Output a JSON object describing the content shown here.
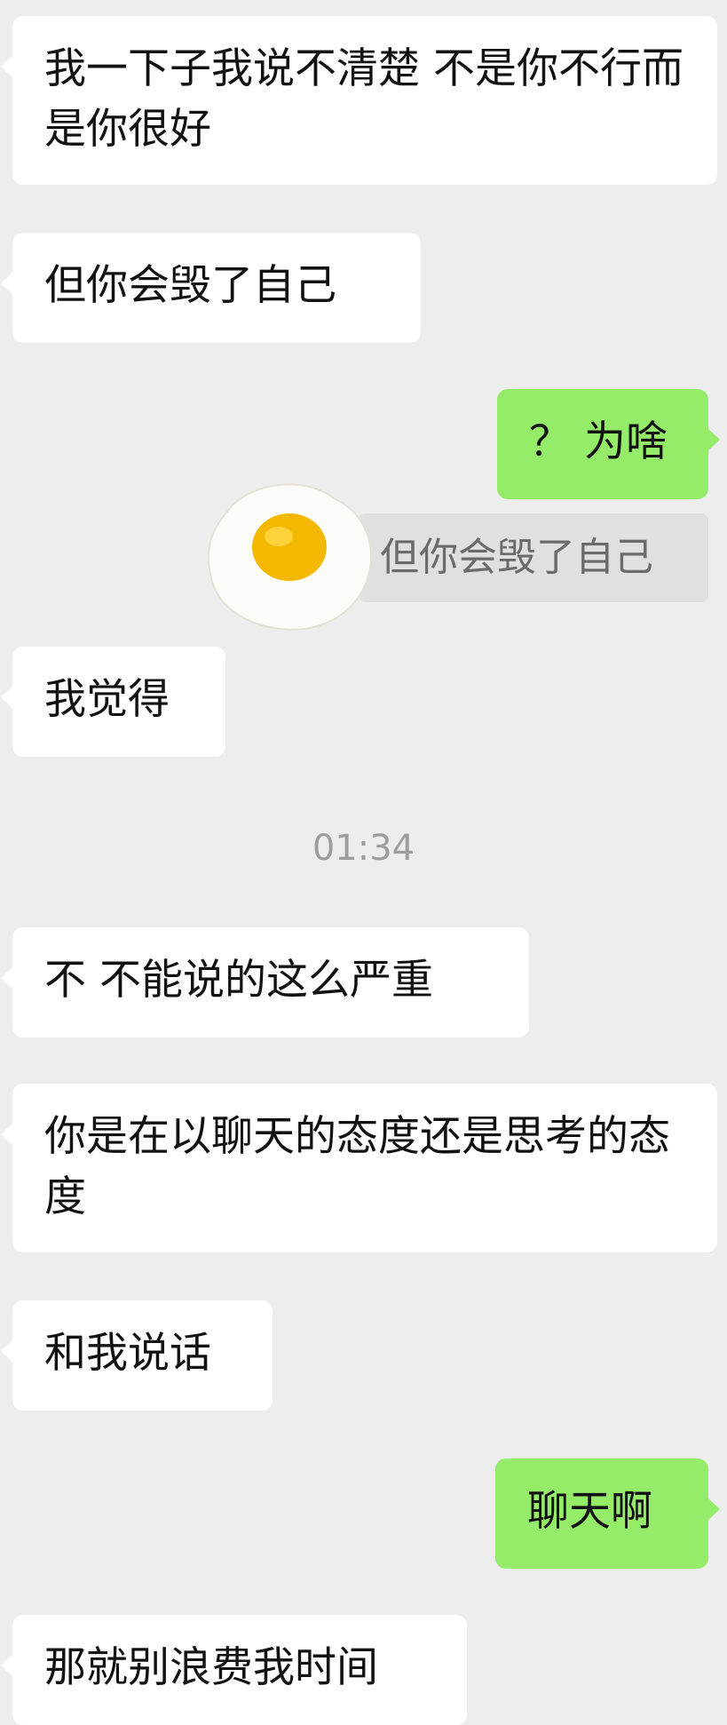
{
  "messages": [
    {
      "side": "left",
      "text": "我一下子我说不清楚 不是你不行而是你很好"
    },
    {
      "side": "left",
      "text": "但你会毁了自己"
    },
    {
      "side": "right",
      "text": "？ 为啥"
    },
    {
      "side": "left",
      "text": "我觉得"
    },
    {
      "side": "left",
      "text": "不 不能说的这么严重"
    },
    {
      "side": "left",
      "text": "你是在以聊天的态度还是思考的态度"
    },
    {
      "side": "left",
      "text": "和我说话"
    },
    {
      "side": "right",
      "text": "聊天啊"
    },
    {
      "side": "left",
      "text": "那就别浪费我时间"
    }
  ],
  "quote": {
    "text": "但你会毁了自己"
  },
  "sticker": {
    "icon": "fried-egg-icon"
  },
  "timestamp": "01:34",
  "colors": {
    "background": "#ededed",
    "incoming": "#ffffff",
    "outgoing": "#95ec69",
    "quote_bg": "#e0e0e0"
  }
}
